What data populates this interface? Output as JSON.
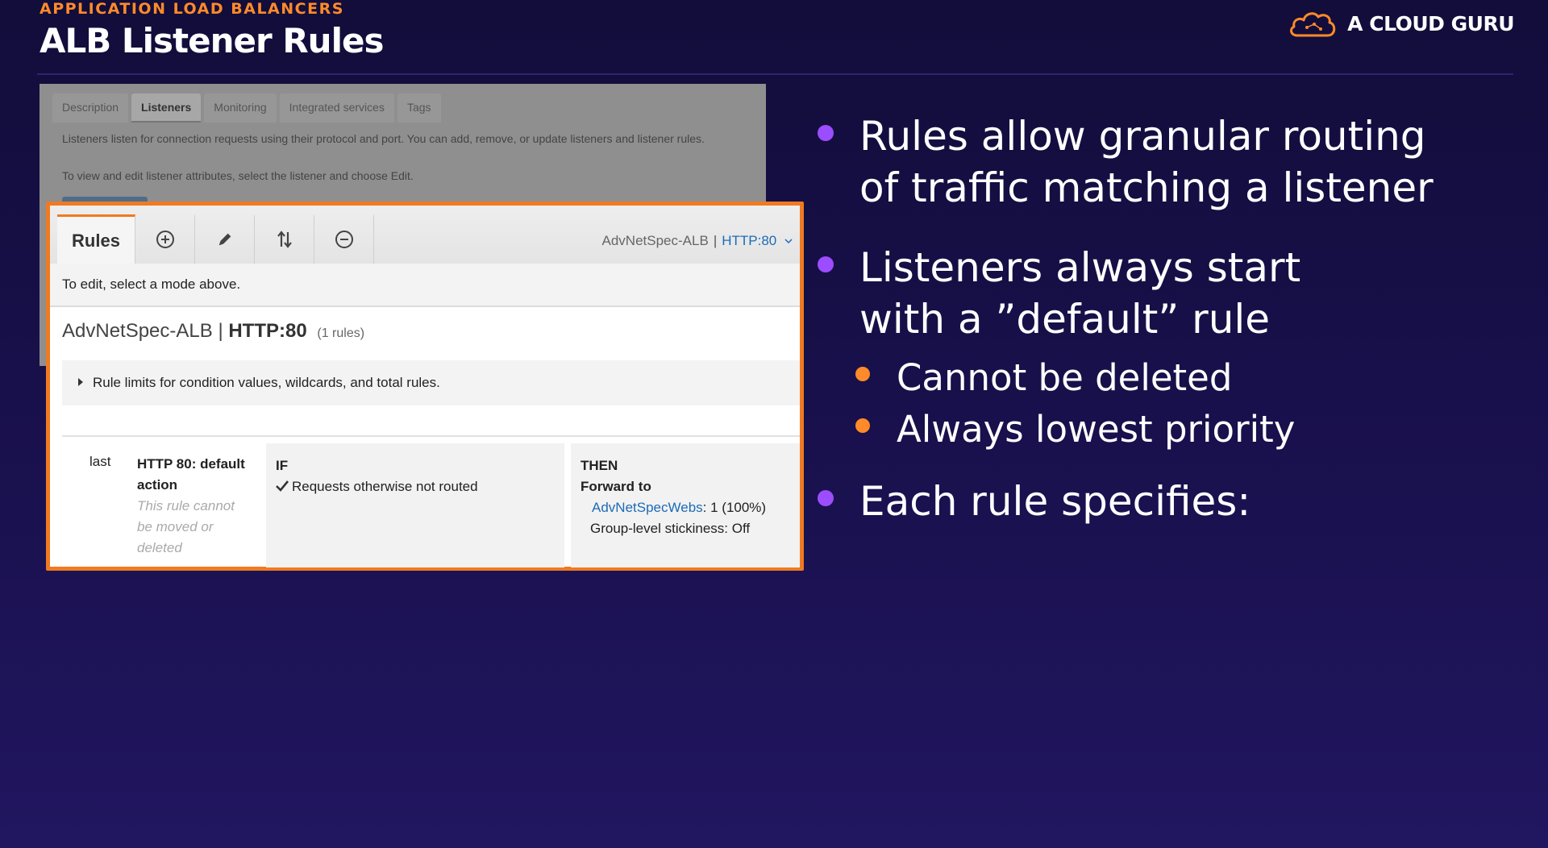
{
  "header": {
    "kicker": "APPLICATION LOAD BALANCERS",
    "title": "ALB Listener Rules",
    "brand": "A CLOUD GURU"
  },
  "console": {
    "tabs": [
      "Description",
      "Listeners",
      "Monitoring",
      "Integrated services",
      "Tags"
    ],
    "active_tab": "Listeners",
    "info_line1": "Listeners listen for connection requests using their protocol and port. You can add, remove, or update listeners and listener rules.",
    "info_line2": "To view and edit listener attributes, select the listener and choose Edit."
  },
  "panel": {
    "rules_tab": "Rules",
    "toolbar_icons": [
      "plus-circle-icon",
      "pencil-icon",
      "reorder-icon",
      "minus-circle-icon"
    ],
    "selector_name": "AdvNetSpec-ALB",
    "selector_sep": "|",
    "selector_port": "HTTP:80",
    "hint": "To edit, select a mode above.",
    "heading_name": "AdvNetSpec-ALB",
    "heading_sep": "|",
    "heading_port": "HTTP:80",
    "heading_count": "(1 rules)",
    "limits": "Rule limits for condition values, wildcards, and total rules.",
    "rule": {
      "priority": "last",
      "name": "HTTP 80: default action",
      "note": "This rule cannot be moved or deleted",
      "if_label": "IF",
      "if_condition": "Requests otherwise not routed",
      "then_label": "THEN",
      "action": "Forward to",
      "target": "AdvNetSpecWebs",
      "target_weight": ": 1 (100%)",
      "stickiness": "Group-level stickiness: Off"
    }
  },
  "bullets": {
    "b1_line1": "Rules allow granular routing",
    "b1_line2": "of traffic matching a listener",
    "b2_line1": "Listeners always start",
    "b2_line2": "with a ”default” rule",
    "b2_sub1": "Cannot be deleted",
    "b2_sub2": "Always lowest priority",
    "b3": "Each rule specifies:"
  },
  "colors": {
    "accent": "#ff8a2a",
    "bullet": "#9b4dff",
    "panel_border": "#ef7a22",
    "link": "#1d6bb6"
  }
}
